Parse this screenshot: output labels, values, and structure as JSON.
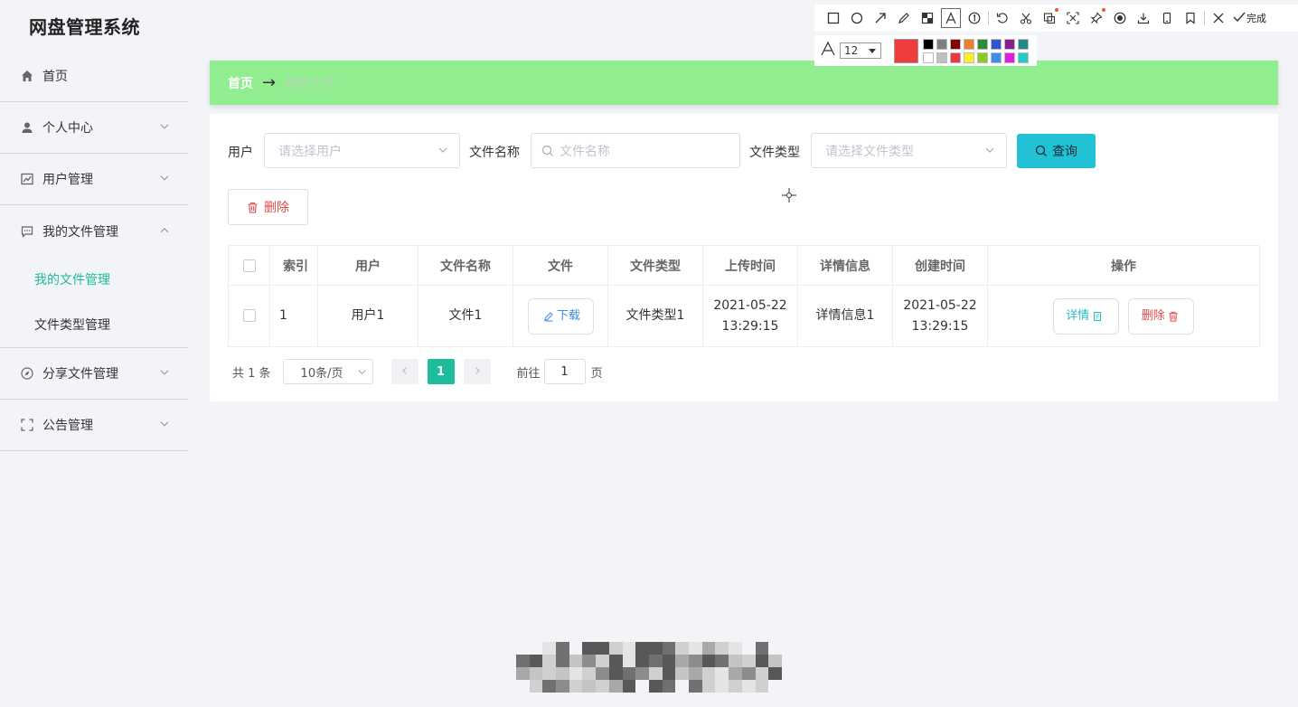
{
  "app": {
    "title": "网盘管理系统"
  },
  "sidebar": {
    "items": [
      {
        "label": "首页",
        "icon": "home-icon"
      },
      {
        "label": "个人中心",
        "icon": "user-icon"
      },
      {
        "label": "用户管理",
        "icon": "chart-icon"
      },
      {
        "label": "我的文件管理",
        "icon": "message-icon"
      },
      {
        "label": "分享文件管理",
        "icon": "compass-icon"
      },
      {
        "label": "公告管理",
        "icon": "fullscreen-icon"
      }
    ],
    "submenu": [
      {
        "label": "我的文件管理",
        "active": true
      },
      {
        "label": "文件类型管理",
        "active": false
      }
    ]
  },
  "breadcrumb": {
    "home": "首页",
    "separator": "→",
    "current": "我的文件"
  },
  "filters": {
    "user_label": "用户",
    "user_placeholder": "请选择用户",
    "filename_label": "文件名称",
    "filename_placeholder": "文件名称",
    "filetype_label": "文件类型",
    "filetype_placeholder": "请选择文件类型",
    "query_button": "查询"
  },
  "actions": {
    "delete_button": "删除"
  },
  "table": {
    "columns": [
      "索引",
      "用户",
      "文件名称",
      "文件",
      "文件类型",
      "上传时间",
      "详情信息",
      "创建时间",
      "操作"
    ],
    "rows": [
      {
        "index": "1",
        "user": "用户1",
        "filename": "文件1",
        "file_button": "下载",
        "filetype": "文件类型1",
        "upload_date": "2021-05-22",
        "upload_time": "13:29:15",
        "detail": "详情信息1",
        "create_date": "2021-05-22",
        "create_time": "13:29:15",
        "detail_button": "详情",
        "delete_button": "删除"
      }
    ]
  },
  "pagination": {
    "total": "共 1 条",
    "page_size": "10条/页",
    "current_page": "1",
    "goto_label": "前往",
    "goto_value": "1",
    "page_suffix": "页"
  },
  "screenshot_tool": {
    "done_label": "完成",
    "font_size": "12",
    "current_color": "#f03c3c",
    "palette": [
      "#000000",
      "#808080",
      "#800000",
      "#e8822c",
      "#2e8b3a",
      "#3355cc",
      "#8a1e8a",
      "#1e8a8a",
      "#ffffff",
      "#c0c0c0",
      "#e83c3c",
      "#ffee22",
      "#88cc22",
      "#3a8ee6",
      "#e020e0",
      "#22cccc"
    ]
  }
}
